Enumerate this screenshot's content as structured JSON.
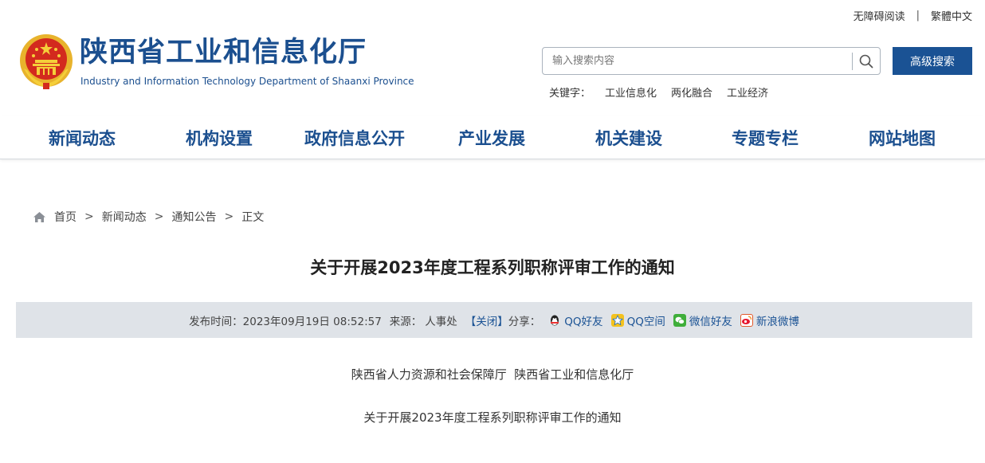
{
  "top_links": {
    "accessible": "无障碍阅读",
    "separator": "|",
    "traditional": "繁體中文"
  },
  "header": {
    "title": "陕西省工业和信息化厅",
    "subtitle": "Industry and Information Technology Department of Shaanxi Province"
  },
  "search": {
    "placeholder": "输入搜索内容",
    "advanced_label": "高级搜索"
  },
  "keywords": {
    "label": "关键字：",
    "items": [
      "工业信息化",
      "两化融合",
      "工业经济"
    ]
  },
  "nav": {
    "items": [
      "新闻动态",
      "机构设置",
      "政府信息公开",
      "产业发展",
      "机关建设",
      "专题专栏",
      "网站地图"
    ]
  },
  "breadcrumb": {
    "home": "首页",
    "arrow": ">",
    "items": [
      "新闻动态",
      "通知公告",
      "正文"
    ]
  },
  "article": {
    "title": "关于开展2023年度工程系列职称评审工作的通知",
    "publish_label": "发布时间：",
    "publish_time": "2023年09月19日 08:52:57",
    "source_label": "来源：",
    "source": "人事处",
    "close_label": "【关闭】",
    "share_label": "分享：",
    "share": [
      "QQ好友",
      "QQ空间",
      "微信好友",
      "新浪微博"
    ],
    "paragraphs": [
      "陕西省人力资源和社会保障厅  陕西省工业和信息化厅",
      "关于开展2023年度工程系列职称评审工作的通知"
    ]
  },
  "colors": {
    "brand_blue": "#1b4f8f",
    "button_blue": "#1a5294",
    "meta_bg": "#dfe3e8"
  }
}
